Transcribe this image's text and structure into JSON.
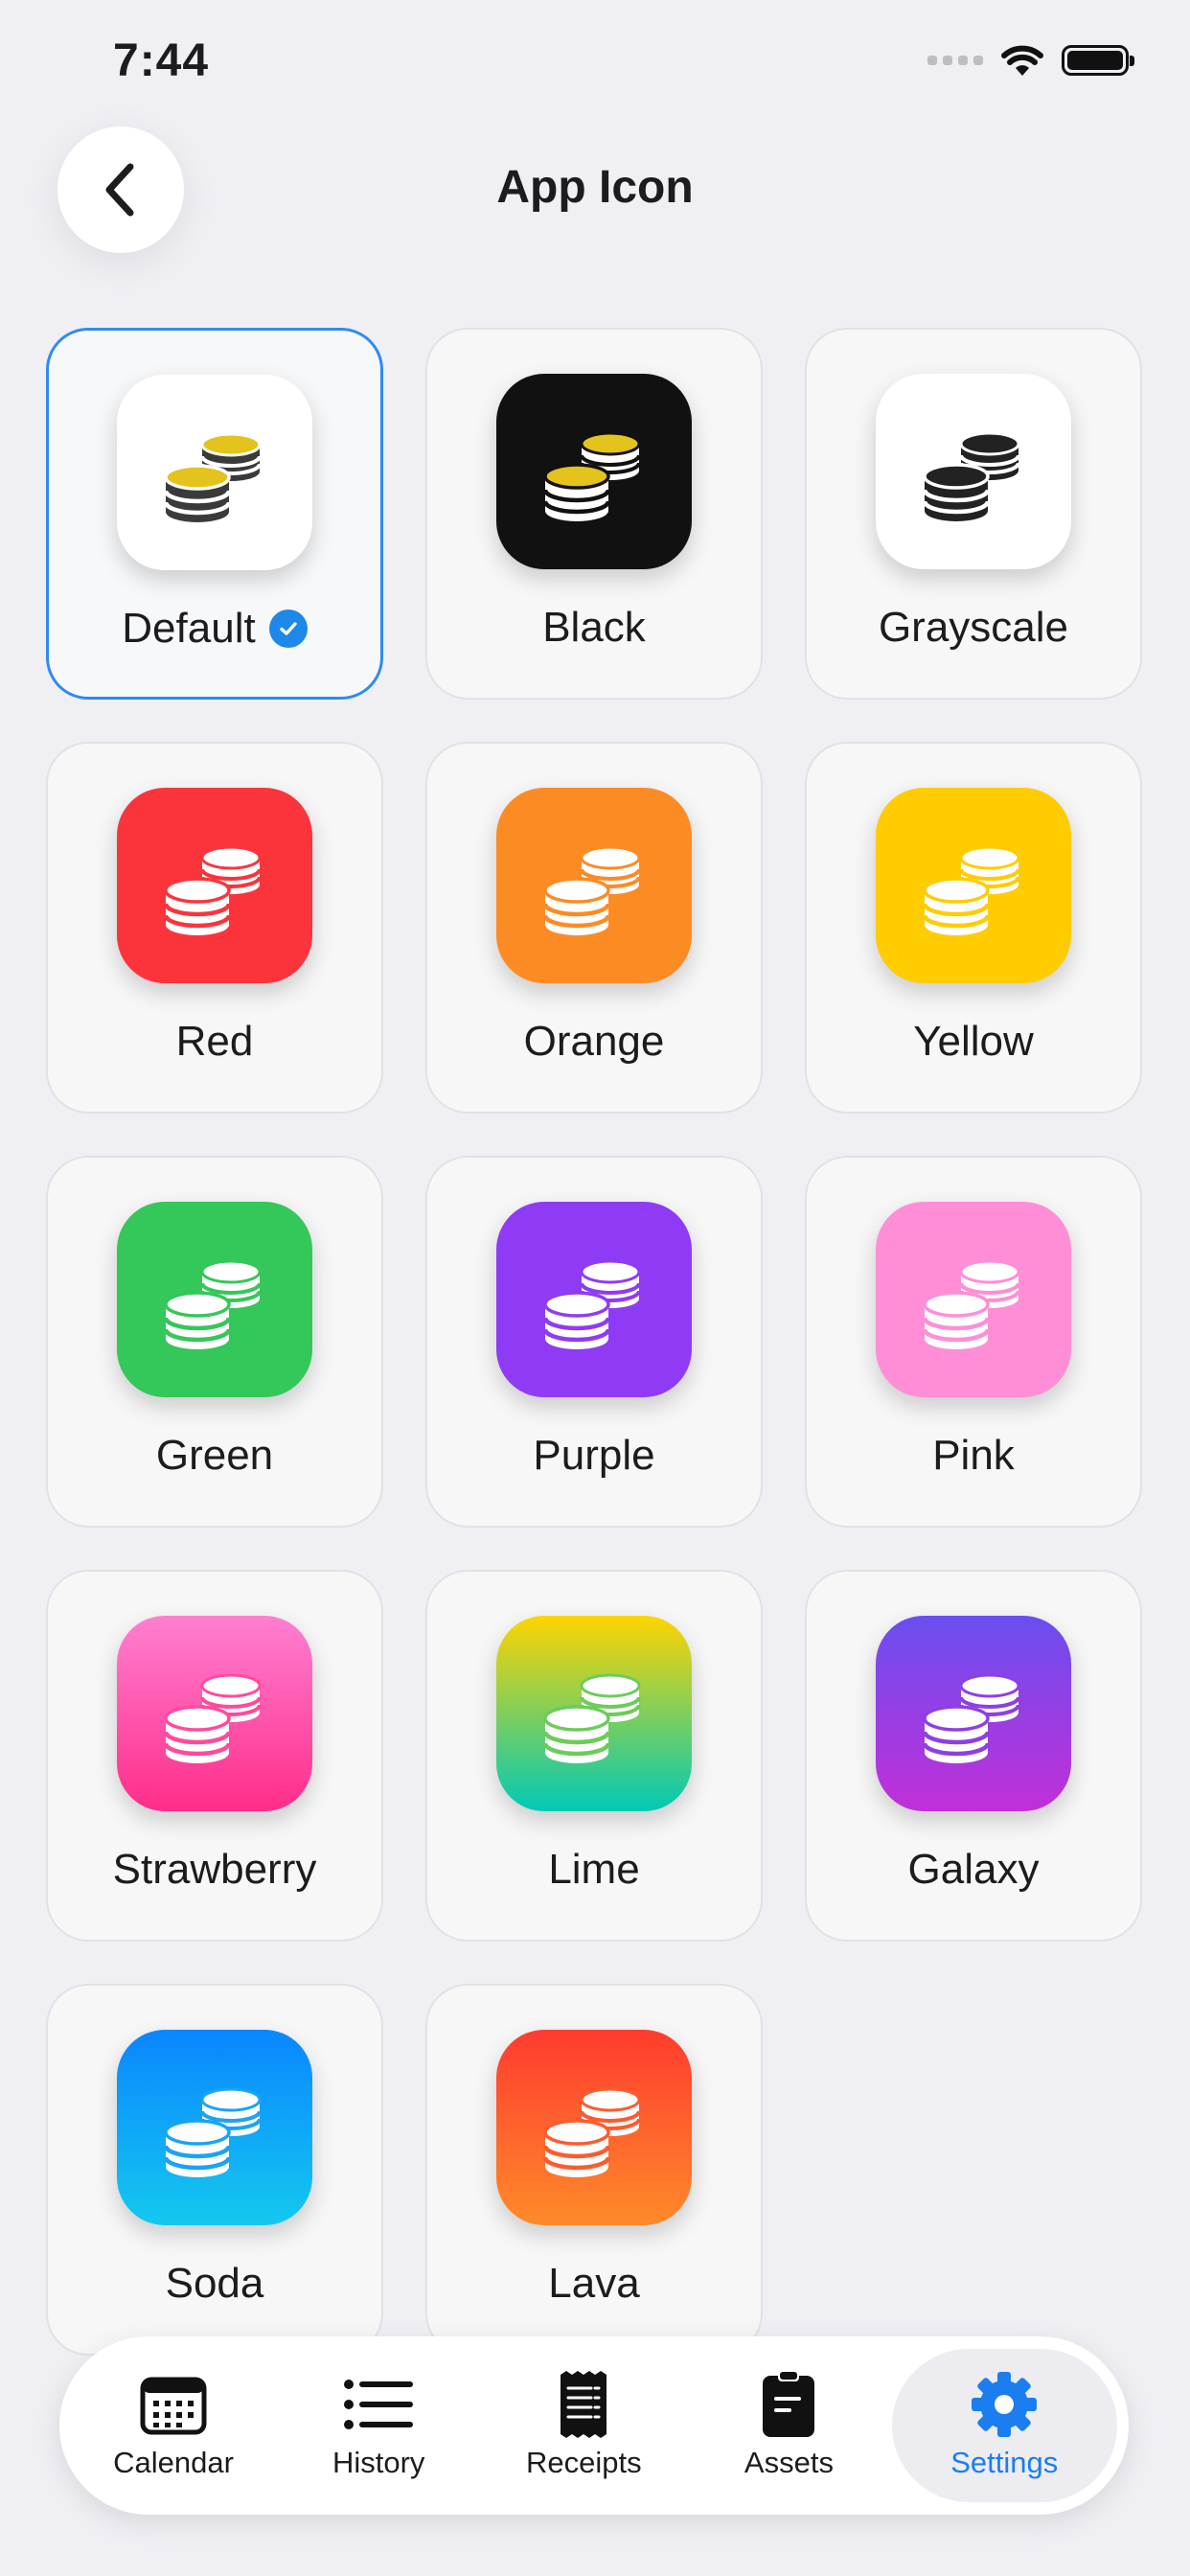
{
  "status_bar": {
    "time": "7:44"
  },
  "header": {
    "title": "App Icon"
  },
  "icons": [
    {
      "label": "Default",
      "selected": true,
      "bg": "#ffffff",
      "coin_top": "#e3c31c",
      "coin_body": "#3a3a3a",
      "coin_line": "#ffffff"
    },
    {
      "label": "Black",
      "selected": false,
      "bg": "#111111",
      "coin_top": "#e3c31c",
      "coin_body": "#ffffff",
      "coin_line": "#111111"
    },
    {
      "label": "Grayscale",
      "selected": false,
      "bg": "#ffffff",
      "coin_top": "#222222",
      "coin_body": "#222222",
      "coin_line": "#ffffff"
    },
    {
      "label": "Red",
      "selected": false,
      "bg": "#fb343c",
      "coin_top": "#ffffff",
      "coin_body": "#ffffff",
      "coin_line": "#fb343c"
    },
    {
      "label": "Orange",
      "selected": false,
      "bg": "#fd8b24",
      "coin_top": "#ffffff",
      "coin_body": "#ffffff",
      "coin_line": "#fd8b24"
    },
    {
      "label": "Yellow",
      "selected": false,
      "bg": "#ffcc00",
      "coin_top": "#ffffff",
      "coin_body": "#ffffff",
      "coin_line": "#ffcc00"
    },
    {
      "label": "Green",
      "selected": false,
      "bg": "#34c759",
      "coin_top": "#ffffff",
      "coin_body": "#ffffff",
      "coin_line": "#34c759"
    },
    {
      "label": "Purple",
      "selected": false,
      "bg": "#8f3bf5",
      "coin_top": "#ffffff",
      "coin_body": "#ffffff",
      "coin_line": "#8f3bf5"
    },
    {
      "label": "Pink",
      "selected": false,
      "bg": "#ff8ed6",
      "coin_top": "#ffffff",
      "coin_body": "#ffffff",
      "coin_line": "#ff8ed6"
    },
    {
      "label": "Strawberry",
      "selected": false,
      "bg": "linear-gradient(180deg,#ff7fd0,#ff2d8a)",
      "coin_top": "#ffffff",
      "coin_body": "#ffffff",
      "coin_line": "#ff4a9c"
    },
    {
      "label": "Lime",
      "selected": false,
      "bg": "linear-gradient(180deg,#ffd400,#00c9b6)",
      "coin_top": "#ffffff",
      "coin_body": "#ffffff",
      "coin_line": "#6ccc5a"
    },
    {
      "label": "Galaxy",
      "selected": false,
      "bg": "linear-gradient(180deg,#6a4ef0,#c22fd8)",
      "coin_top": "#ffffff",
      "coin_body": "#ffffff",
      "coin_line": "#8e3fe4"
    },
    {
      "label": "Soda",
      "selected": false,
      "bg": "linear-gradient(180deg,#0a86ff,#14c8ef)",
      "coin_top": "#ffffff",
      "coin_body": "#ffffff",
      "coin_line": "#1aa3f7"
    },
    {
      "label": "Lava",
      "selected": false,
      "bg": "linear-gradient(180deg,#ff3b2f,#ff8a2a)",
      "coin_top": "#ffffff",
      "coin_body": "#ffffff",
      "coin_line": "#ff5a2e"
    }
  ],
  "tab_bar": {
    "tabs": [
      {
        "label": "Calendar",
        "icon": "calendar-icon",
        "active": false
      },
      {
        "label": "History",
        "icon": "list-icon",
        "active": false
      },
      {
        "label": "Receipts",
        "icon": "receipt-icon",
        "active": false
      },
      {
        "label": "Assets",
        "icon": "clipboard-icon",
        "active": false
      },
      {
        "label": "Settings",
        "icon": "gear-icon",
        "active": true
      }
    ]
  },
  "colors": {
    "accent": "#1a7ef0",
    "selected_border": "#2f8cf0",
    "background": "#efeff4"
  }
}
